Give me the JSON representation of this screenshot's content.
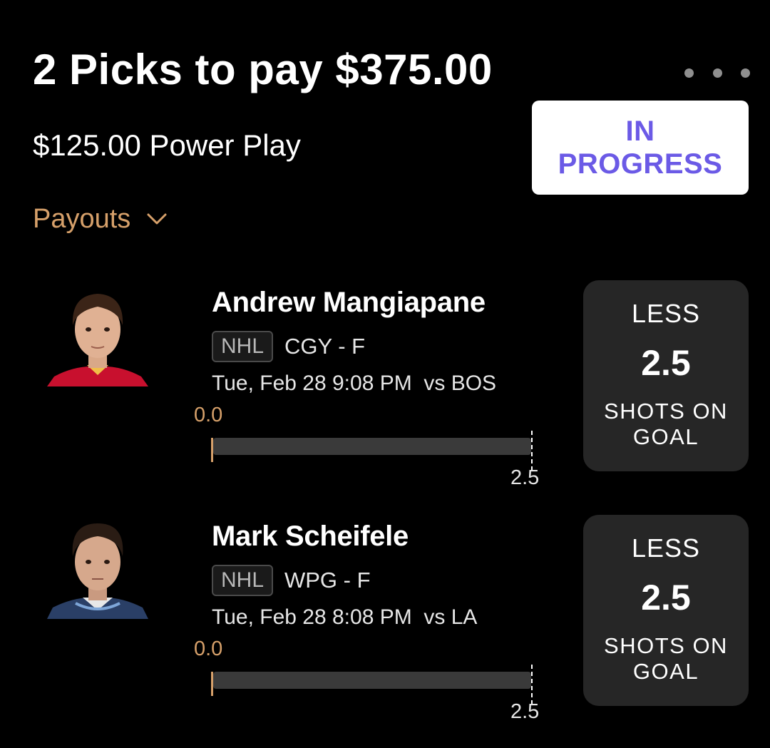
{
  "header": {
    "title": "2 Picks to pay $375.00",
    "subtitle": "$125.00 Power Play",
    "status": "IN PROGRESS",
    "payouts_label": "Payouts",
    "more_icon": "more-horizontal-icon",
    "payouts_icon": "chevron-down-icon"
  },
  "colors": {
    "background": "#000000",
    "accent_gold": "#d6a06a",
    "status_purple": "#6b5ae6",
    "card_bg": "#262626",
    "track": "#3a3a3a"
  },
  "picks": [
    {
      "player": "Andrew Mangiapane",
      "league": "NHL",
      "team_position": "CGY - F",
      "game_time": "Tue, Feb 28 9:08 PM  vs BOS",
      "progress_start_label": "0.0",
      "progress_end_label": "2.5",
      "progress_value": 0.0,
      "progress_target": 2.5,
      "direction": "LESS",
      "line": "2.5",
      "stat": "SHOTS ON GOAL",
      "jersey_color": "#c8102e"
    },
    {
      "player": "Mark Scheifele",
      "league": "NHL",
      "team_position": "WPG - F",
      "game_time": "Tue, Feb 28 8:08 PM  vs LA",
      "progress_start_label": "0.0",
      "progress_end_label": "2.5",
      "progress_value": 0.0,
      "progress_target": 2.5,
      "direction": "LESS",
      "line": "2.5",
      "stat": "SHOTS ON GOAL",
      "jersey_color": "#2a3f66"
    }
  ]
}
